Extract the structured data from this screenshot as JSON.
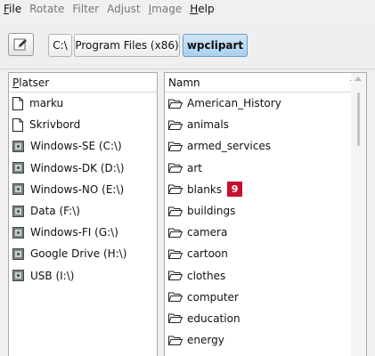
{
  "menu": {
    "file": {
      "mnemonic": "F",
      "rest": "ile"
    },
    "rotate": "Rotate",
    "filter": "Filter",
    "adjust": "Adjust",
    "image": {
      "mnemonic": "I",
      "rest": "mage"
    },
    "help": {
      "mnemonic": "H",
      "rest": "elp"
    }
  },
  "breadcrumb": [
    "C:\\",
    "Program Files (x86)",
    "wpclipart"
  ],
  "places": {
    "header": {
      "mnemonic": "P",
      "rest": "latser"
    },
    "items": [
      {
        "label": "marku",
        "icon": "document-icon"
      },
      {
        "label": "Skrivbord",
        "icon": "document-icon"
      },
      {
        "label": "Windows-SE (C:\\)",
        "icon": "drive-icon"
      },
      {
        "label": "Windows-DK (D:\\)",
        "icon": "drive-icon"
      },
      {
        "label": "Windows-NO (E:\\)",
        "icon": "drive-icon"
      },
      {
        "label": "Data (F:\\)",
        "icon": "drive-icon"
      },
      {
        "label": "Windows-FI (G:\\)",
        "icon": "drive-icon"
      },
      {
        "label": "Google Drive (H:\\)",
        "icon": "drive-icon"
      },
      {
        "label": "USB (I:\\)",
        "icon": "drive-icon"
      }
    ]
  },
  "files": {
    "header": "Namn",
    "items": [
      {
        "label": "American_History"
      },
      {
        "label": "animals"
      },
      {
        "label": "armed_services"
      },
      {
        "label": "art"
      },
      {
        "label": "blanks",
        "badge": "9"
      },
      {
        "label": "buildings"
      },
      {
        "label": "camera"
      },
      {
        "label": "cartoon"
      },
      {
        "label": "clothes"
      },
      {
        "label": "computer"
      },
      {
        "label": "education"
      },
      {
        "label": "energy"
      }
    ]
  },
  "colors": {
    "badge": "#c8102e",
    "selected_crumb": "#a9d0ef"
  }
}
